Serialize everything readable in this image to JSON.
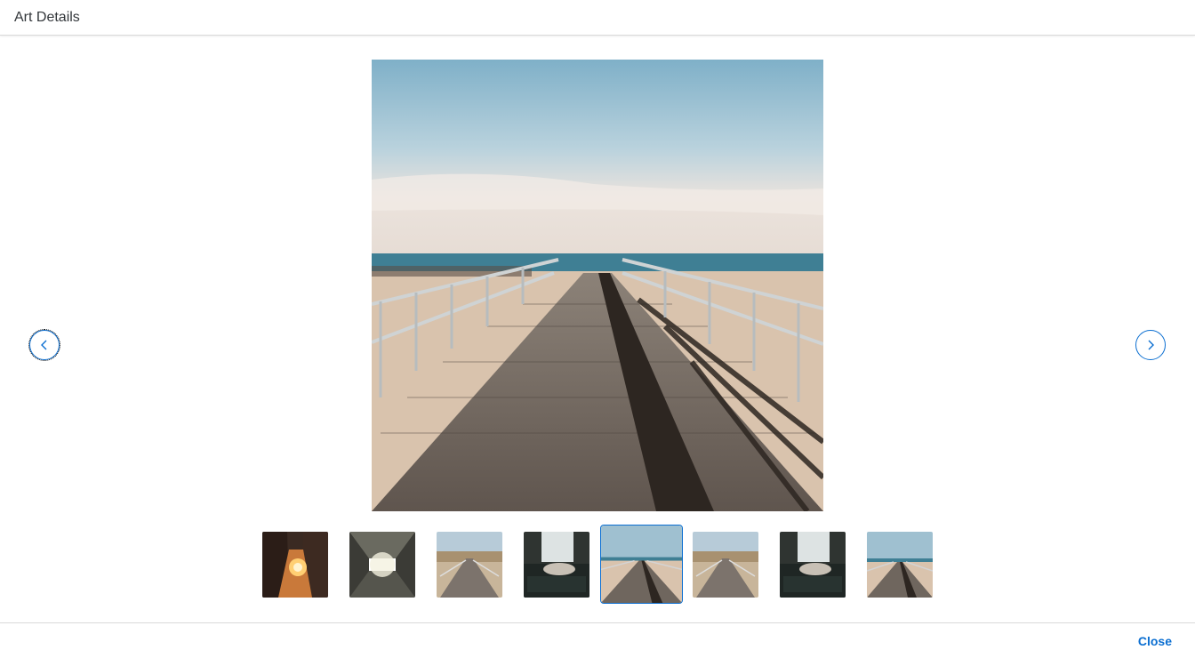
{
  "dialog": {
    "title": "Art Details"
  },
  "carousel": {
    "current_index": 5,
    "total": 8,
    "thumbnails": [
      {
        "subject": "sunset-city-street"
      },
      {
        "subject": "skylight-building"
      },
      {
        "subject": "boardwalk-dunes"
      },
      {
        "subject": "window-sofa-room"
      },
      {
        "subject": "beach-boardwalk"
      },
      {
        "subject": "boardwalk-dunes"
      },
      {
        "subject": "window-sofa-room"
      },
      {
        "subject": "beach-boardwalk"
      }
    ]
  },
  "icons": {
    "prev": "chevron-left-icon",
    "next": "chevron-right-icon"
  },
  "footer": {
    "close_label": "Close"
  },
  "colors": {
    "accent": "#0a6ed1",
    "text": "#32363a",
    "border": "#d9d9d9"
  }
}
